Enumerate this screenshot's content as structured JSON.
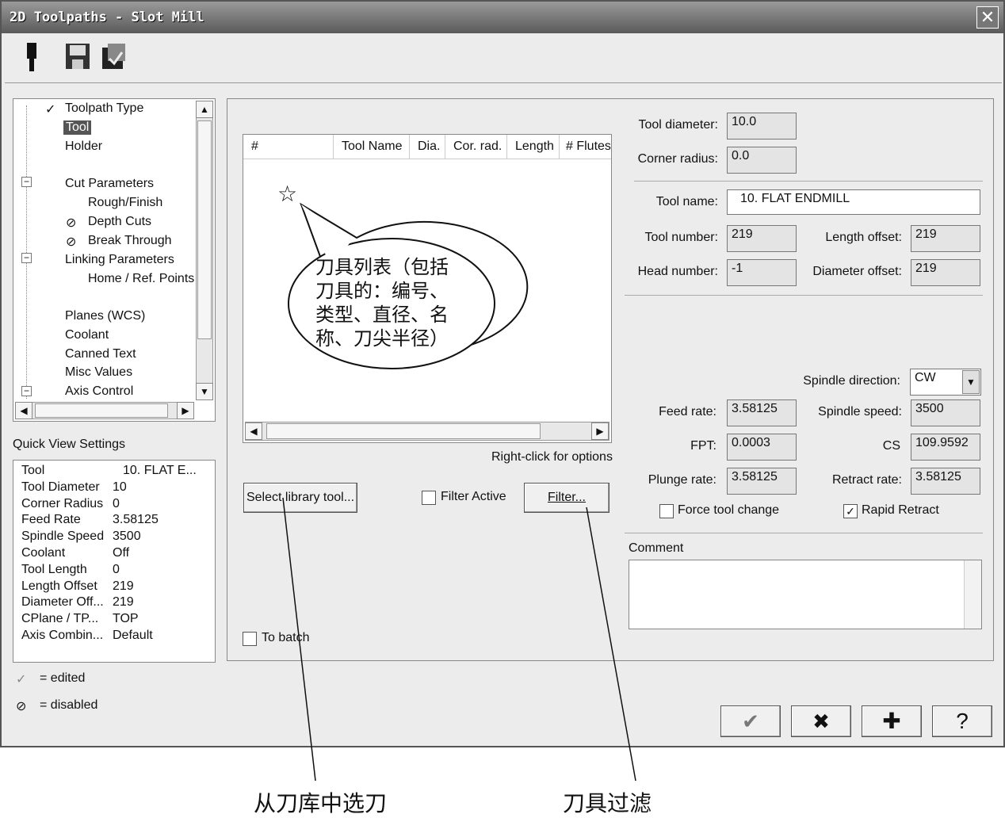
{
  "window": {
    "title": "2D Toolpaths - Slot Mill"
  },
  "toolbar": {
    "icons": [
      "tool-holder-icon",
      "save-icon",
      "save-as-icon"
    ]
  },
  "tree": {
    "items": [
      {
        "label": "Toolpath Type",
        "mark": "✓"
      },
      {
        "label": "Tool",
        "selected": true
      },
      {
        "label": "Holder"
      },
      {
        "label": "Cut Parameters",
        "expander": "−"
      },
      {
        "label": "Rough/Finish"
      },
      {
        "label": "Depth Cuts",
        "mark": "⊘"
      },
      {
        "label": "Break Through",
        "mark": "⊘"
      },
      {
        "label": "Linking Parameters",
        "expander": "−"
      },
      {
        "label": "Home / Ref. Points"
      },
      {
        "label": "Planes (WCS)"
      },
      {
        "label": "Coolant"
      },
      {
        "label": "Canned Text"
      },
      {
        "label": "Misc Values"
      },
      {
        "label": "Axis Control",
        "expander": "−"
      }
    ]
  },
  "quick_view": {
    "title": "Quick View Settings",
    "rows": [
      [
        "Tool",
        "10. FLAT E..."
      ],
      [
        "Tool Diameter",
        "10"
      ],
      [
        "Corner Radius",
        "0"
      ],
      [
        "Feed Rate",
        "3.58125"
      ],
      [
        "Spindle Speed",
        "3500"
      ],
      [
        "Coolant",
        "Off"
      ],
      [
        "Tool Length",
        "0"
      ],
      [
        "Length Offset",
        "219"
      ],
      [
        "Diameter Off...",
        "219"
      ],
      [
        "CPlane / TP...",
        "TOP"
      ],
      [
        "Axis Combin...",
        "Default"
      ]
    ]
  },
  "legend": {
    "edited": "= edited",
    "disabled": "= disabled",
    "edited_mark": "✓",
    "disabled_mark": "⊘"
  },
  "tool_list": {
    "columns": [
      "#",
      "Tool Name",
      "Dia.",
      "Cor. rad.",
      "Length",
      "# Flutes"
    ],
    "hint": "Right-click for options"
  },
  "buttons": {
    "select_library": "Select library tool...",
    "filter": "Filter...",
    "ok": "✔",
    "cancel": "✖",
    "add": "✚",
    "help": "?"
  },
  "checks": {
    "filter_active": "Filter Active",
    "to_batch": "To batch",
    "force_tool_change": "Force tool change",
    "rapid_retract": "Rapid Retract"
  },
  "fields": {
    "tool_diameter": {
      "label": "Tool diameter:",
      "value": "10.0"
    },
    "corner_radius": {
      "label": "Corner radius:",
      "value": "0.0"
    },
    "tool_name": {
      "label": "Tool name:",
      "value": "10. FLAT ENDMILL"
    },
    "tool_number": {
      "label": "Tool number:",
      "value": "219"
    },
    "length_offset": {
      "label": "Length offset:",
      "value": "219"
    },
    "head_number": {
      "label": "Head number:",
      "value": "-1"
    },
    "diameter_offset": {
      "label": "Diameter offset:",
      "value": "219"
    },
    "spindle_direction": {
      "label": "Spindle direction:",
      "value": "CW"
    },
    "feed_rate": {
      "label": "Feed rate:",
      "value": "3.58125"
    },
    "spindle_speed": {
      "label": "Spindle speed:",
      "value": "3500"
    },
    "fpt": {
      "label": "FPT:",
      "value": "0.0003"
    },
    "cs": {
      "label": "CS",
      "value": "109.9592"
    },
    "plunge_rate": {
      "label": "Plunge rate:",
      "value": "3.58125"
    },
    "retract_rate": {
      "label": "Retract rate:",
      "value": "3.58125"
    },
    "comment": {
      "label": "Comment",
      "value": ""
    }
  },
  "annotations": {
    "bubble": "刀具列表（包括刀具的：编号、类型、直径、名称、刀尖半径）",
    "bubble_lines": [
      "刀具列表（包括",
      "刀具的：编号、",
      "类型、直径、名",
      "称、刀尖半径）"
    ],
    "star": "☆",
    "select_caption": "从刀库中选刀",
    "filter_caption": "刀具过滤"
  }
}
